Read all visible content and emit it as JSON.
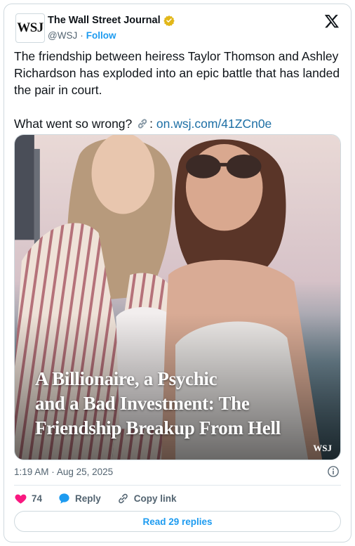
{
  "account": {
    "avatar_text": "WSJ",
    "name": "The Wall Street Journal",
    "handle": "@WSJ",
    "separator": "·",
    "follow_label": "Follow",
    "verified_color": "#e2b719"
  },
  "tweet": {
    "text_line1": "The friendship between heiress Taylor Thomson and Ashley Richardson has exploded into an epic battle that has landed the pair in court.",
    "question": "What went so wrong?",
    "link_sep": ":",
    "link_text": "on.wsj.com/41ZCn0e"
  },
  "media": {
    "headline_line1": "A Billionaire, a Psychic",
    "headline_line2": "and a Bad Investment: The",
    "headline_line3": "Friendship Breakup From Hell",
    "brand": "WSJ"
  },
  "meta": {
    "time": "1:19 AM",
    "separator": "·",
    "date": "Aug 25, 2025"
  },
  "actions": {
    "like_count": "74",
    "reply_label": "Reply",
    "copy_label": "Copy link"
  },
  "footer": {
    "read_replies_label": "Read 29 replies"
  },
  "colors": {
    "accent": "#1d9bf0",
    "like": "#f91880",
    "link": "#1d6fa5"
  }
}
